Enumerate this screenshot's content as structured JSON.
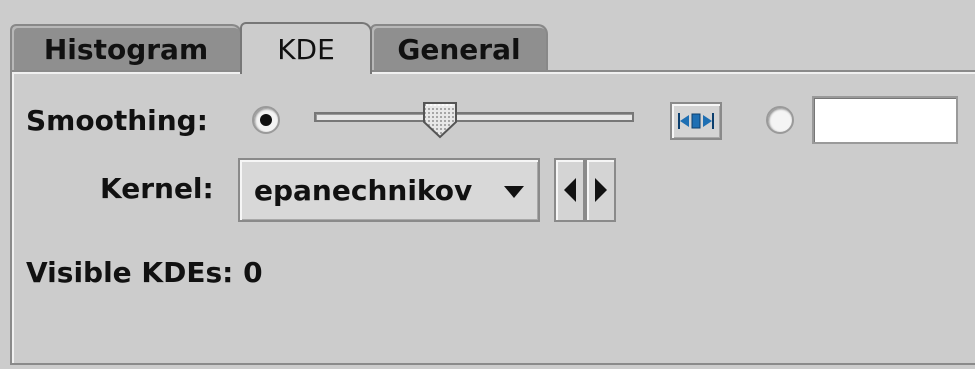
{
  "tabs": [
    {
      "label": "Histogram",
      "active": false
    },
    {
      "label": "KDE",
      "active": true
    },
    {
      "label": "General",
      "active": false
    }
  ],
  "smoothing": {
    "label": "Smoothing:",
    "slider_selected": true,
    "text_selected": false,
    "slider_value_fraction": 0.38,
    "text_value": "",
    "reset_icon": "fit-width-icon",
    "accent_color": "#1e6fb3"
  },
  "kernel": {
    "label": "Kernel:",
    "selected": "epanechnikov",
    "prev_icon": "triangle-left-icon",
    "next_icon": "triangle-right-icon"
  },
  "visible_kdes": {
    "text": "Visible KDEs: 0"
  }
}
